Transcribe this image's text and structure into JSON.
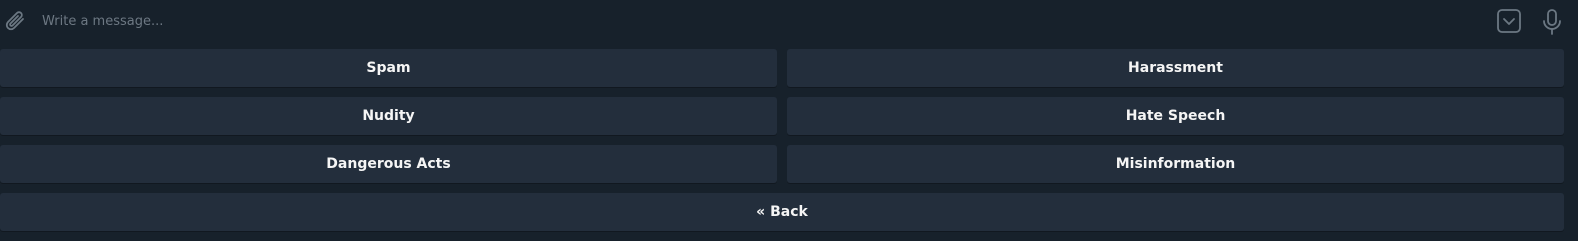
{
  "composer": {
    "placeholder": "Write a message..."
  },
  "icons": {
    "attach": "paperclip-icon",
    "keyboard_toggle": "keyboard-toggle-icon",
    "mic": "microphone-icon"
  },
  "keyboard": {
    "rows": [
      [
        "Spam",
        "Harassment"
      ],
      [
        "Nudity",
        "Hate Speech"
      ],
      [
        "Dangerous Acts",
        "Misinformation"
      ],
      [
        "« Back"
      ]
    ]
  },
  "colors": {
    "background": "#17212b",
    "button": "#232e3c",
    "text": "#f5f5f5",
    "icon": "#6c7883"
  }
}
